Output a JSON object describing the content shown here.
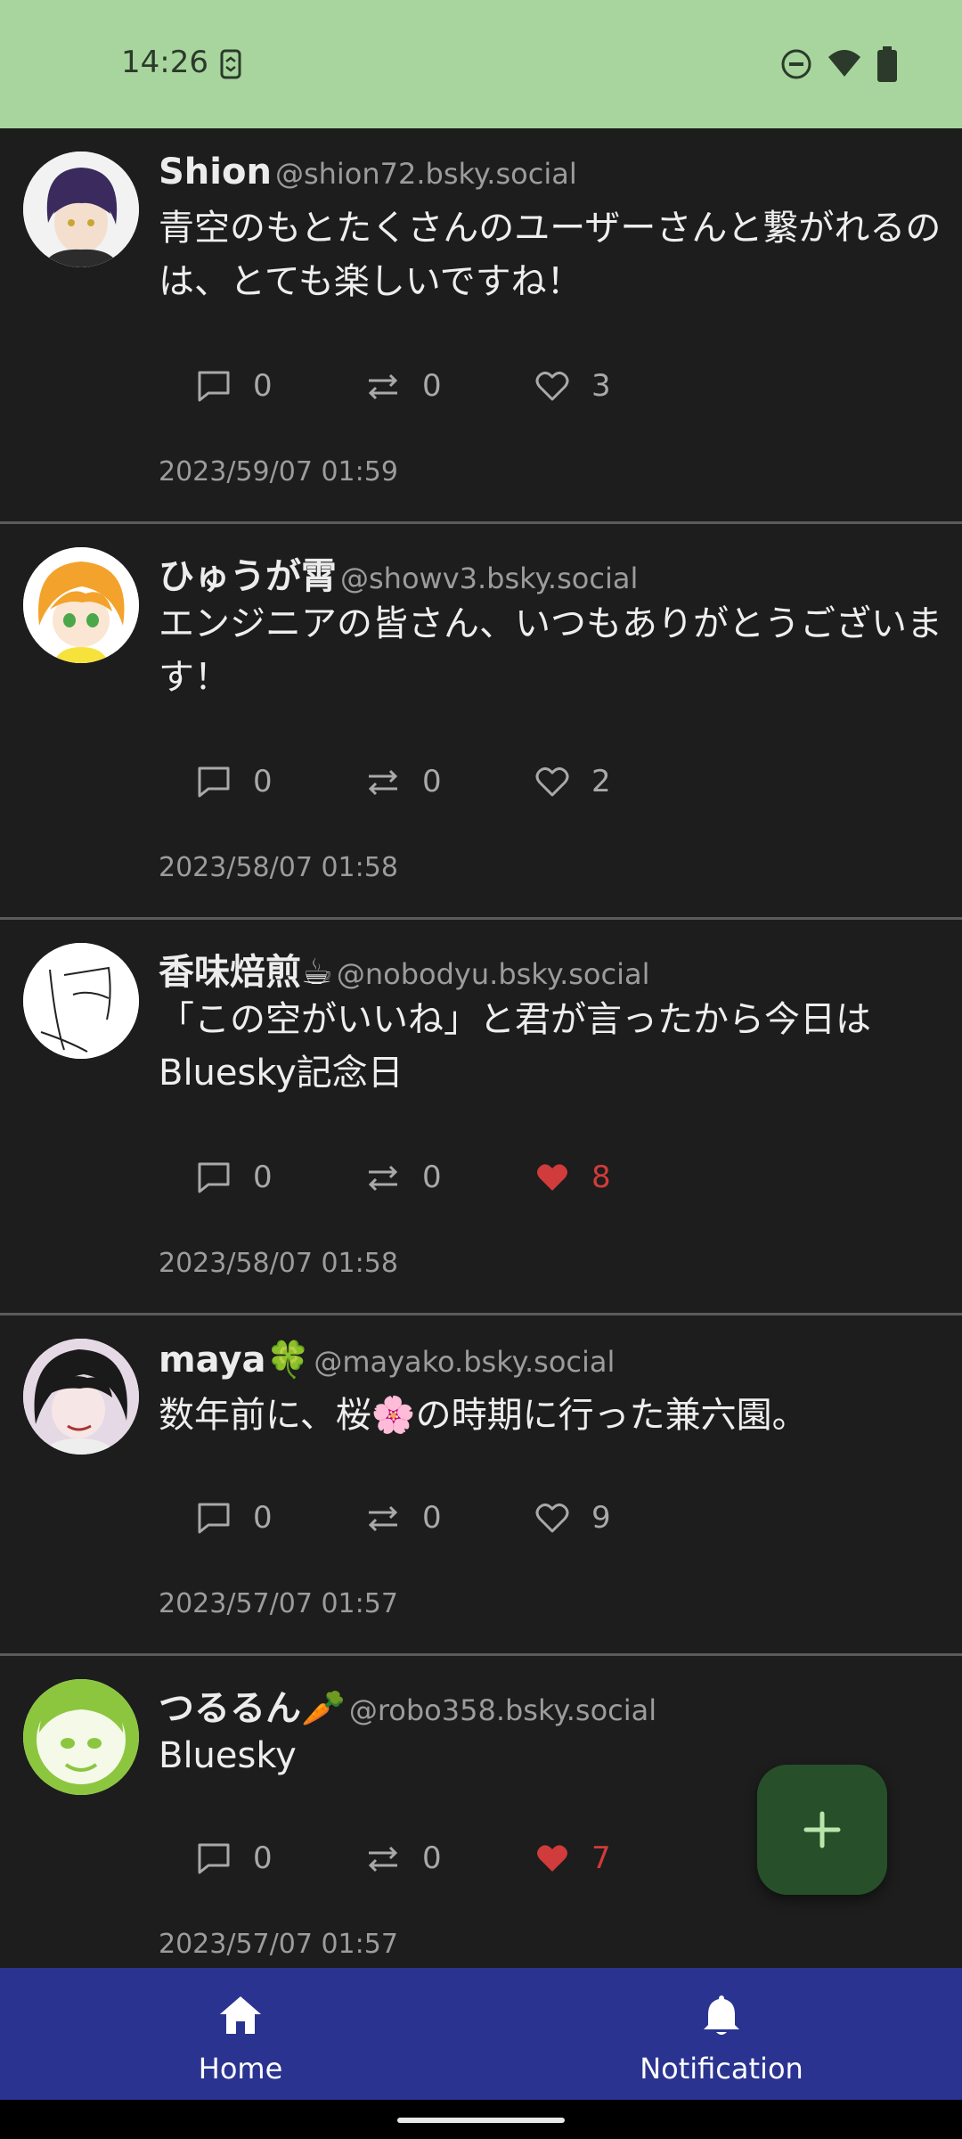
{
  "status_bar": {
    "time": "14:26",
    "icons": [
      "sync-icon",
      "do-not-disturb-icon",
      "wifi-icon",
      "battery-icon"
    ]
  },
  "posts": [
    {
      "display_name": "Shion",
      "handle": "@shion72.bsky.social",
      "text": "青空のもとたくさんのユーザーさんと繋がれるのは、とても楽しいですね！",
      "replies": "0",
      "reposts": "0",
      "likes": "3",
      "liked": false,
      "timestamp": "2023/59/07 01:59"
    },
    {
      "display_name": "ひゅうが霄",
      "handle": "@showv3.bsky.social",
      "text": "エンジニアの皆さん、いつもありがとうございます！",
      "replies": "0",
      "reposts": "0",
      "likes": "2",
      "liked": false,
      "timestamp": "2023/58/07 01:58"
    },
    {
      "display_name": "香味焙煎☕",
      "handle": "@nobodyu.bsky.social",
      "text": "「この空がいいね」と君が言ったから今日はBluesky記念日",
      "replies": "0",
      "reposts": "0",
      "likes": "8",
      "liked": true,
      "timestamp": "2023/58/07 01:58"
    },
    {
      "display_name": "maya🍀",
      "handle": "@mayako.bsky.social",
      "text": "数年前に、桜🌸の時期に行った兼六園。",
      "replies": "0",
      "reposts": "0",
      "likes": "9",
      "liked": false,
      "timestamp": "2023/57/07 01:57"
    },
    {
      "display_name": "つるるん🥕",
      "handle": "@robo358.bsky.social",
      "text": "Bluesky",
      "replies": "0",
      "reposts": "0",
      "likes": "7",
      "liked": true,
      "timestamp": "2023/57/07 01:57"
    }
  ],
  "fab": {
    "icon": "plus-icon"
  },
  "bottom_nav": {
    "home": {
      "label": "Home",
      "icon": "home-icon"
    },
    "notification": {
      "label": "Notification",
      "icon": "bell-icon"
    }
  },
  "colors": {
    "status_bar": "#a8d59d",
    "background": "#1c1d1c",
    "liked": "#d03b3b",
    "nav": "#2a3490",
    "fab": "#27502a"
  }
}
